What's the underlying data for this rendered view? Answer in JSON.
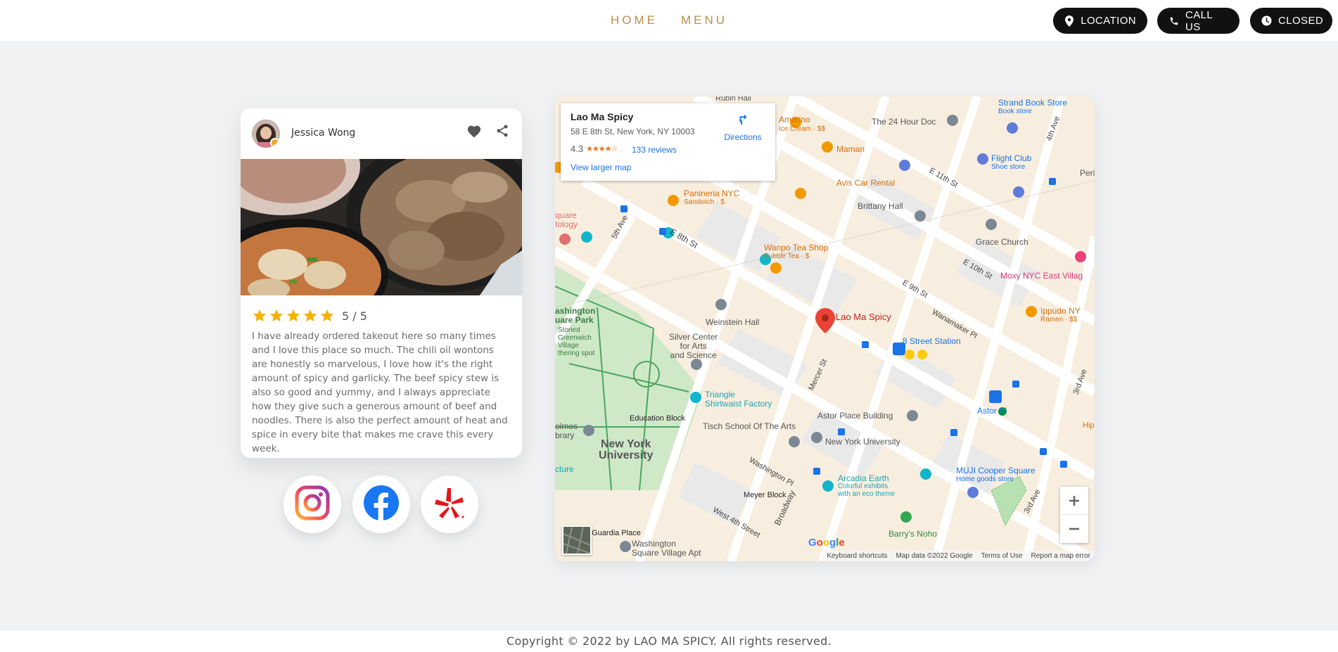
{
  "nav": {
    "home": "HOME",
    "menu": "MENU",
    "location": "LOCATION",
    "call_us": "CALL US",
    "closed": "CLOSED"
  },
  "review": {
    "reviewer": "Jessica Wong",
    "score": "5 / 5",
    "stars": 5,
    "text": "I have already ordered takeout here so many times and I love this place so much. The chili oil wontons are honestly so marvelous, I love how it's the right amount of spicy and garlicky. The beef spicy stew is also so good and yummy, and I always appreciate how they give such a generous amount of beef and noodles. There is also the perfect amount of heat and spice in every bite that makes me crave this every week."
  },
  "social": [
    "instagram-icon",
    "facebook-icon",
    "yelp-icon"
  ],
  "map": {
    "place_name": "Lao Ma Spicy",
    "address": "58 E 8th St, New York, NY 10003",
    "rating": "4.3",
    "rating_stars": "★★★★☆",
    "reviews": "133 reviews",
    "directions": "Directions",
    "view_larger": "View larger map",
    "attribution": {
      "shortcuts": "Keyboard shortcuts",
      "data": "Map data ©2022 Google",
      "terms": "Terms of Use",
      "report": "Report a map error"
    },
    "google": "Google",
    "labels": {
      "strand": "Strand Book Store",
      "strand_sub": "Book store",
      "amorino": "Amorino",
      "amorino_sub": "Ice Cream · $$",
      "hour": "The 24 Hour Doc",
      "maman": "Maman",
      "flight": "Flight Club",
      "flight_sub": "Shoe store",
      "avis": "Avis Car Rental",
      "paninieria": "Panineria NYC",
      "paninieria_sub": "Sandwich · $",
      "brittany": "Brittany Hall",
      "grace": "Grace Church",
      "wanpo": "Wanpo Tea Shop",
      "wanpo_sub": "Bubble Tea · $",
      "moxy": "Moxy NYC East Villag",
      "ippudo": "Ippudo NY",
      "ippudo_sub": "Ramen · $$",
      "lao": "Lao Ma Spicy",
      "weinstein": "Weinstein Hall",
      "silver": "Silver Center\nfor Arts\nand Science",
      "eighth_station": "8 Street Station",
      "astor_pl": "Astor Pl",
      "triangle": "Triangle\nShirtwaist Factory",
      "astor_bldg": "Astor Place Building",
      "education": "Education Block",
      "tisch": "Tisch School Of The Arts",
      "nyu": "New York\nUniversity",
      "nyu_small": "New York University",
      "arcadia": "Arcadia Earth",
      "arcadia_sub": "Colorful exhibits\nwith an eco theme",
      "muji": "MUJI Cooper Square",
      "muji_sub": "Home goods store",
      "meyer": "Meyer Block",
      "barrys": "Barry's Noho",
      "wsq_apt": "Washington\nSquare Village Apt",
      "laguardia": "aGuardia Place",
      "wsq_park": "ashington\nuare Park",
      "stories": "Storied\nGreenwich\nVillage\nthering spot",
      "quare": "quare\ntology",
      "olmes": "olmes\nbrary",
      "cture": "cture",
      "rubin": "Rubin Hall",
      "peri": "Peri",
      "hip": "Hip",
      "st_e8": "E 8th St",
      "st_e9": "E 9th St",
      "st_e10": "E 10th St",
      "st_e11": "E 11th St",
      "st_5ave": "5th Ave",
      "st_4ave": "4th Ave",
      "st_3ave": "3rd Ave",
      "st_3ave2": "3rd Ave",
      "st_mercer": "Mercer St",
      "st_wash": "Washington Pl",
      "st_w4": "West 4th Street",
      "st_bway": "Broadway",
      "st_wana": "Wanamaker Pl"
    }
  },
  "footer": {
    "copyright": "Copyright © 2022 by LAO MA SPICY. All rights reserved."
  }
}
